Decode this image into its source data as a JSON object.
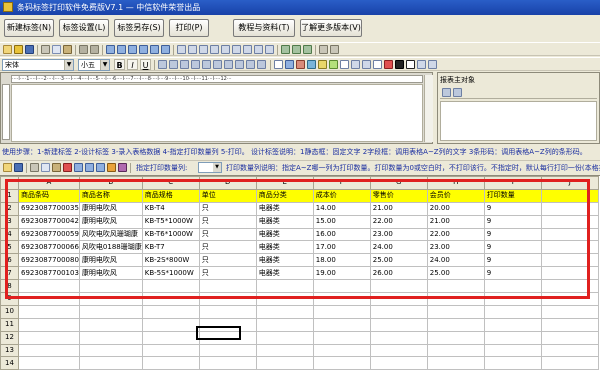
{
  "window": {
    "title": "条码标签打印软件免费版V7.1 — 中信软件荣誉出品"
  },
  "top_buttons": {
    "new_label": "新建标签(N)",
    "label_settings": "标签设置(L)",
    "save_as": "标签另存(S)",
    "print": "打印(P)",
    "tutorial": "教程与资料(T)",
    "more_versions": "了解更多版本(V)"
  },
  "format_bar": {
    "font_name": "宋体",
    "font_size": "小五",
    "bold": "B",
    "italic": "I",
    "underline": "U"
  },
  "right_panel": {
    "title": "报表主对象"
  },
  "instructions": "使用步骤：1-新建标签 2-设计标签 3-录入表格数据 4-指定打印数量列 5-打印。 设计标签说明：1静态框：固定文字 2字段框：调用表格A~Z列的文字 3条形码：调用表格A~Z列的条形码。",
  "sheet_toolbar": {
    "print_count_label": "指定打印数量列:",
    "print_count_value": "",
    "note": "打印数量列说明：指定A~Z哪一列为打印数量。打印数量为0或空白时，不打印该行。不指定时，默认每行打印一份(本格打印)"
  },
  "sheet": {
    "columns": [
      "A",
      "B",
      "C",
      "D",
      "E",
      "F",
      "G",
      "H",
      "I",
      "J"
    ],
    "row_numbers": [
      "1",
      "2",
      "3",
      "4",
      "5",
      "6",
      "7",
      "8",
      "9",
      "10",
      "11",
      "12",
      "13",
      "14"
    ],
    "rows": [
      [
        "商品条码",
        "商品名称",
        "商品规格",
        "单位",
        "商品分类",
        "成本价",
        "零售价",
        "会员价",
        "打印数量",
        ""
      ],
      [
        "6923087700035",
        "康明电吹风",
        "KB-T4",
        "只",
        "电器类",
        "14.00",
        "21.00",
        "20.00",
        "9",
        ""
      ],
      [
        "6923087700042",
        "康明电吹风",
        "KB-T5*1000W",
        "只",
        "电器类",
        "15.00",
        "22.00",
        "21.00",
        "9",
        ""
      ],
      [
        "6923087700059",
        "风吹电吹风珊瑚康",
        "KB-T6*1000W",
        "只",
        "电器类",
        "16.00",
        "23.00",
        "22.00",
        "9",
        ""
      ],
      [
        "6923087700066",
        "风吹电0188珊瑚康",
        "KB-T7",
        "只",
        "电器类",
        "17.00",
        "24.00",
        "23.00",
        "9",
        ""
      ],
      [
        "6923087700080",
        "康明电吹风",
        "KB-2S*800W",
        "只",
        "电器类",
        "18.00",
        "25.00",
        "24.00",
        "9",
        ""
      ],
      [
        "6923087700103",
        "康明电吹风",
        "KB-5S*1000W",
        "只",
        "电器类",
        "19.00",
        "26.00",
        "25.00",
        "9",
        ""
      ],
      [
        "",
        "",
        "",
        "",
        "",
        "",
        "",
        "",
        "",
        ""
      ],
      [
        "",
        "",
        "",
        "",
        "",
        "",
        "",
        "",
        "",
        ""
      ],
      [
        "",
        "",
        "",
        "",
        "",
        "",
        "",
        "",
        "",
        ""
      ],
      [
        "",
        "",
        "",
        "",
        "",
        "",
        "",
        "",
        "",
        ""
      ],
      [
        "",
        "",
        "",
        "",
        "",
        "",
        "",
        "",
        "",
        ""
      ],
      [
        "",
        "",
        "",
        "",
        "",
        "",
        "",
        "",
        "",
        ""
      ],
      [
        "",
        "",
        "",
        "",
        "",
        "",
        "",
        "",
        "",
        ""
      ]
    ]
  },
  "colors": {
    "title_bar": "#2a5ec7",
    "header_row": "#ffff00",
    "highlight_box": "#e0201f",
    "instructions_text": "#1a2ea0"
  }
}
